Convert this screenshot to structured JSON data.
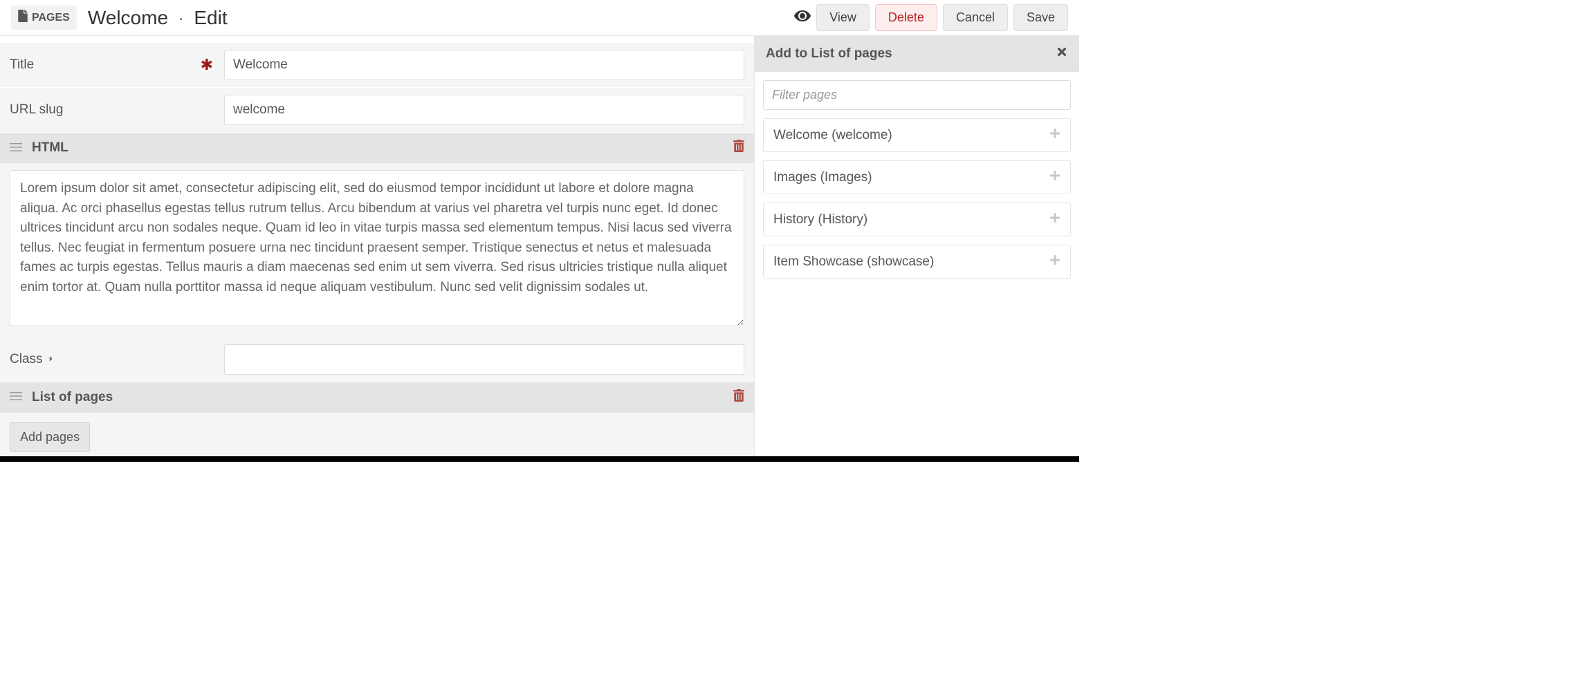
{
  "header": {
    "pages_label": "PAGES",
    "breadcrumb_item": "Welcome",
    "breadcrumb_sep": "·",
    "breadcrumb_action": "Edit",
    "buttons": {
      "view": "View",
      "delete": "Delete",
      "cancel": "Cancel",
      "save": "Save"
    }
  },
  "form": {
    "title_label": "Title",
    "title_value": "Welcome",
    "url_label": "URL slug",
    "url_value": "welcome",
    "class_label": "Class",
    "class_value": ""
  },
  "sections": {
    "html_label": "HTML",
    "html_value": "Lorem ipsum dolor sit amet, consectetur adipiscing elit, sed do eiusmod tempor incididunt ut labore et dolore magna aliqua. Ac orci phasellus egestas tellus rutrum tellus. Arcu bibendum at varius vel pharetra vel turpis nunc eget. Id donec ultrices tincidunt arcu non sodales neque. Quam id leo in vitae turpis massa sed elementum tempus. Nisi lacus sed viverra tellus. Nec feugiat in fermentum posuere urna nec tincidunt praesent semper. Tristique senectus et netus et malesuada fames ac turpis egestas. Tellus mauris a diam maecenas sed enim ut sem viverra. Sed risus ultricies tristique nulla aliquet enim tortor at. Quam nulla porttitor massa id neque aliquam vestibulum. Nunc sed velit dignissim sodales ut.",
    "list_label": "List of pages",
    "add_pages_label": "Add pages"
  },
  "sidebar": {
    "title": "Add to List of pages",
    "filter_placeholder": "Filter pages",
    "items": [
      {
        "label": "Welcome (welcome)"
      },
      {
        "label": "Images (Images)"
      },
      {
        "label": "History (History)"
      },
      {
        "label": "Item Showcase (showcase)"
      }
    ]
  }
}
